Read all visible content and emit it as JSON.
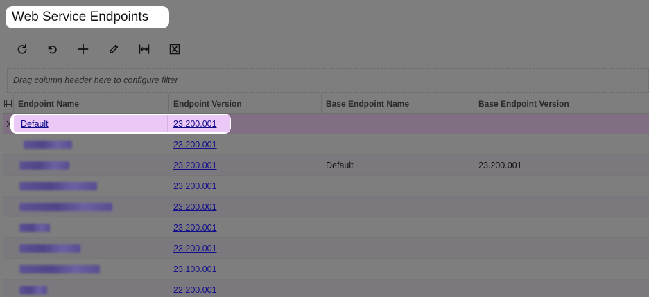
{
  "page": {
    "title": "Web Service Endpoints"
  },
  "toolbar": {
    "buttons": [
      {
        "icon": "refresh-icon"
      },
      {
        "icon": "undo-icon"
      },
      {
        "icon": "plus-icon"
      },
      {
        "icon": "pencil-icon"
      },
      {
        "icon": "fit-columns-icon"
      },
      {
        "icon": "excel-export-icon"
      }
    ]
  },
  "filter": {
    "placeholder": "Drag column header here to configure filter"
  },
  "grid": {
    "columns": [
      "Endpoint Name",
      "Endpoint Version",
      "Base Endpoint Name",
      "Base Endpoint Version"
    ],
    "rows": [
      {
        "name": "Default",
        "version": "23.200.001",
        "base_name": "",
        "base_version": ""
      },
      {
        "name": "",
        "version": "23.200.001",
        "base_name": "",
        "base_version": ""
      },
      {
        "name": "",
        "version": "23.200.001",
        "base_name": "Default",
        "base_version": "23.200.001"
      },
      {
        "name": "",
        "version": "23.200.001",
        "base_name": "",
        "base_version": ""
      },
      {
        "name": "",
        "version": "23.200.001",
        "base_name": "",
        "base_version": ""
      },
      {
        "name": "",
        "version": "23.200.001",
        "base_name": "",
        "base_version": ""
      },
      {
        "name": "",
        "version": "23.200.001",
        "base_name": "",
        "base_version": ""
      },
      {
        "name": "",
        "version": "23.100.001",
        "base_name": "",
        "base_version": ""
      },
      {
        "name": "",
        "version": "22.200.001",
        "base_name": "",
        "base_version": ""
      }
    ]
  }
}
